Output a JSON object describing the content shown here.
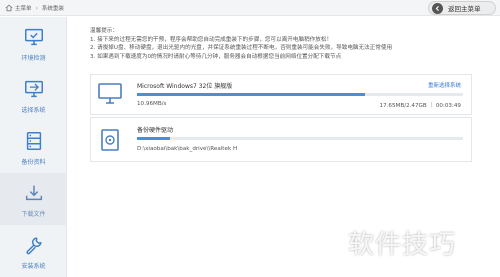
{
  "breadcrumb": {
    "home": "主菜单",
    "current": "系统重装"
  },
  "back_button": {
    "label": "返回主菜单"
  },
  "sidebar": {
    "items": [
      {
        "label": "环境检测",
        "icon": "monitor-check-icon"
      },
      {
        "label": "选择系统",
        "icon": "system-select-icon"
      },
      {
        "label": "备份资料",
        "icon": "backup-icon"
      },
      {
        "label": "下载文件",
        "icon": "download-icon",
        "active": true
      },
      {
        "label": "安装系统",
        "icon": "install-wrench-icon"
      }
    ]
  },
  "notice": {
    "title": "温馨提示：",
    "lines": [
      "1. 接下来的过程无需您的干预，程序会帮助您自动完成重装下的步骤，您可以离开电脑稍作放松！",
      "2. 请拔掉U盘、移动硬盘，退出光驱内的光盘，并保证系统重装过程不断电，否则重装可能会失败，导致电脑无法正常使用",
      "3. 如果遇到下载速度为0的情况时请耐心等待几分钟，服务器会自动根据您当前网络位置分配下载节点"
    ]
  },
  "tasks": [
    {
      "title": "Microsoft Windows7 32位 旗舰版",
      "link": "重新选择系统",
      "left": "10.96MB/s",
      "right": "17.65MB/2.47GB ｜ 00:03:49",
      "progress": 0.7
    },
    {
      "title": "备份硬件驱动",
      "left": "D:\\xiaobai\\bak\\bak_drive\\\\Realtek H",
      "progress": 0.1
    }
  ],
  "watermark": "软件技巧",
  "colors": {
    "accent": "#4a90d9",
    "link": "#3a7bd5",
    "sidebar_bg": "#f0f3f6"
  }
}
